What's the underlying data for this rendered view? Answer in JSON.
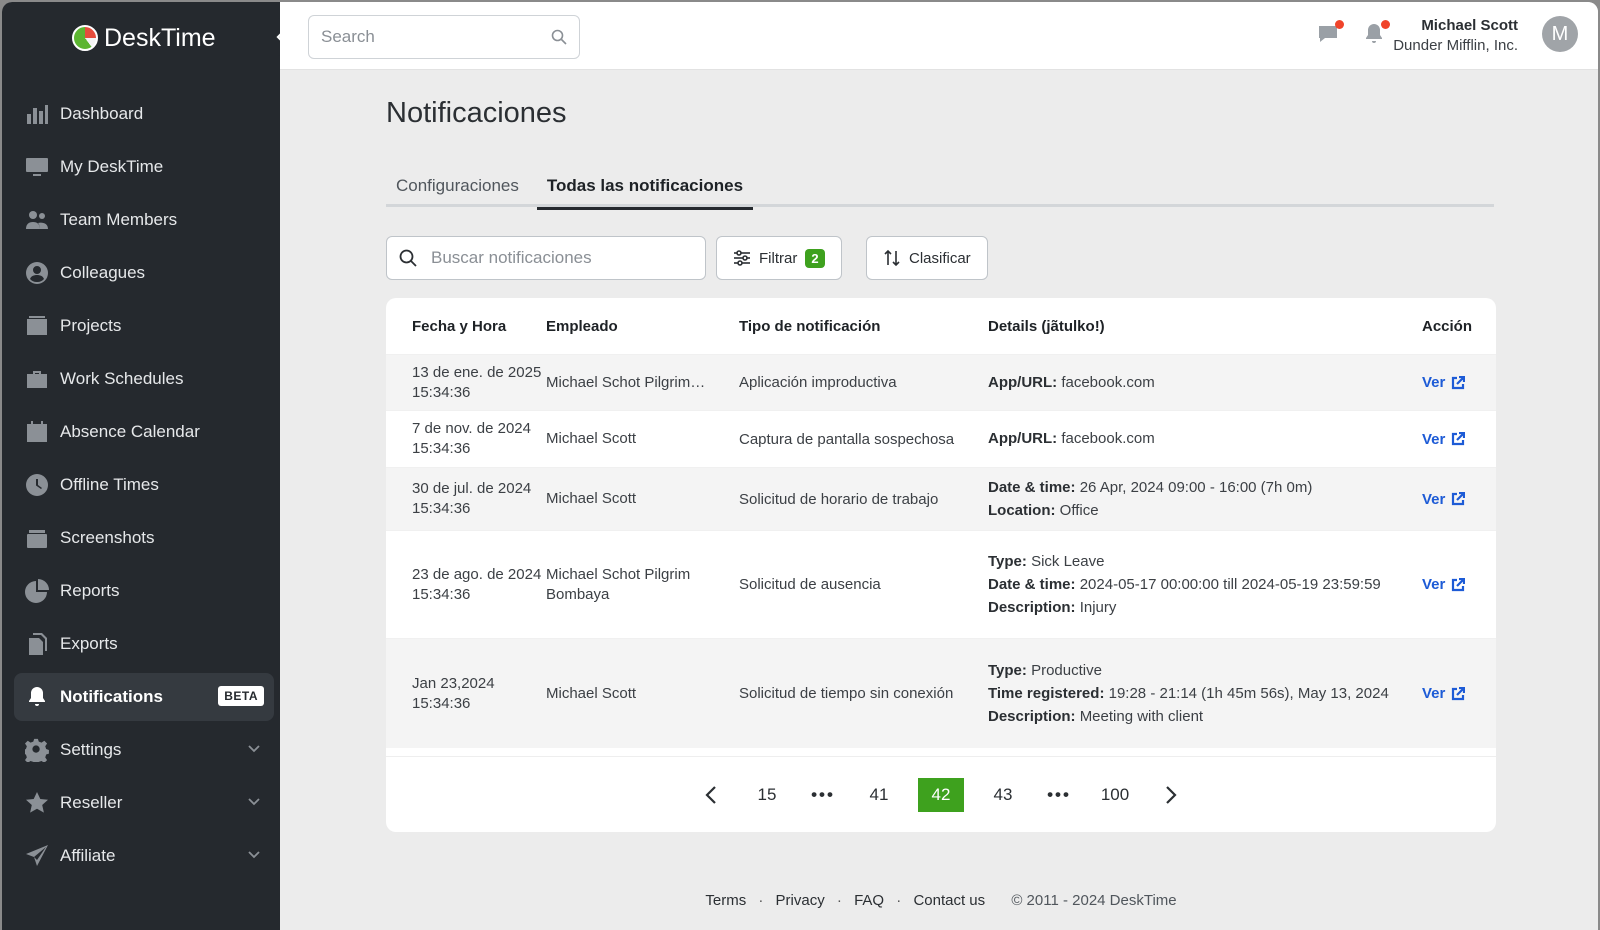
{
  "app": {
    "name": "DeskTime"
  },
  "sidebar": {
    "items": [
      {
        "label": "Dashboard",
        "icon": "bar-chart-icon"
      },
      {
        "label": "My DeskTime",
        "icon": "monitor-icon"
      },
      {
        "label": "Team Members",
        "icon": "team-icon"
      },
      {
        "label": "Colleagues",
        "icon": "person-circle-icon"
      },
      {
        "label": "Projects",
        "icon": "folder-icon"
      },
      {
        "label": "Work Schedules",
        "icon": "briefcase-icon"
      },
      {
        "label": "Absence Calendar",
        "icon": "calendar-icon"
      },
      {
        "label": "Offline Times",
        "icon": "clock-icon"
      },
      {
        "label": "Screenshots",
        "icon": "screenshots-icon"
      },
      {
        "label": "Reports",
        "icon": "pie-chart-icon"
      },
      {
        "label": "Exports",
        "icon": "documents-icon"
      },
      {
        "label": "Notifications",
        "icon": "bell-icon",
        "badge": "BETA",
        "active": true
      },
      {
        "label": "Settings",
        "icon": "gear-icon"
      },
      {
        "label": "Reseller",
        "icon": "star-icon"
      },
      {
        "label": "Affiliate",
        "icon": "paper-plane-icon"
      }
    ]
  },
  "topbar": {
    "search_placeholder": "Search",
    "user_name": "Michael Scott",
    "company": "Dunder Mifflin, Inc.",
    "avatar_letter": "M"
  },
  "page": {
    "title": "Notificaciones",
    "tabs": [
      "Configuraciones",
      "Todas las notificaciones"
    ],
    "active_tab": 1,
    "search_placeholder": "Buscar notificaciones",
    "filter_label": "Filtrar",
    "filter_count": "2",
    "sort_label": "Clasificar"
  },
  "table": {
    "headers": [
      "Fecha y Hora",
      "Empleado",
      "Tipo de notificación",
      "Details (jãtulko!)",
      "Acción"
    ],
    "rows": [
      {
        "date": "13 de ene. de 2025",
        "time": "15:34:36",
        "employee": "Michael  Schot Pilgrim…",
        "type": "Aplicación improductiva",
        "details": [
          {
            "k": "App/URL:",
            "v": "facebook.com"
          }
        ],
        "action": "Ver"
      },
      {
        "date": "7 de nov. de 2024",
        "time": "15:34:36",
        "employee": "Michael Scott",
        "type": "Captura de pantalla sospechosa",
        "details": [
          {
            "k": "App/URL:",
            "v": "facebook.com"
          }
        ],
        "action": "Ver"
      },
      {
        "date": "30 de jul. de 2024",
        "time": "15:34:36",
        "employee": "Michael Scott",
        "type": "Solicitud de horario de trabajo",
        "details": [
          {
            "k": "Date & time:",
            "v": "26 Apr, 2024 09:00 - 16:00 (7h 0m)"
          },
          {
            "k": "Location:",
            "v": "Office"
          }
        ],
        "action": "Ver"
      },
      {
        "date": "23 de ago. de 2024",
        "time": "15:34:36",
        "employee": "Michael  Schot Pilgrim Bombaya",
        "type": "Solicitud de ausencia",
        "details": [
          {
            "k": "Type:",
            "v": "Sick Leave"
          },
          {
            "k": "Date & time:",
            "v": "2024-05-17 00:00:00 till 2024-05-19 23:59:59"
          },
          {
            "k": "Description:",
            "v": "Injury"
          }
        ],
        "action": "Ver"
      },
      {
        "date": "Jan 23,2024",
        "time": "15:34:36",
        "employee": "Michael Scott",
        "type": "Solicitud de tiempo sin conexión",
        "details": [
          {
            "k": "Type:",
            "v": "Productive"
          },
          {
            "k": "Time registered:",
            "v": "19:28 - 21:14 (1h 45m 56s), May 13, 2024"
          },
          {
            "k": "Description:",
            "v": "Meeting with client"
          }
        ],
        "action": "Ver"
      }
    ]
  },
  "pagination": {
    "pages": [
      "15",
      "•••",
      "41",
      "42",
      "43",
      "•••",
      "100"
    ],
    "current": "42"
  },
  "footer": {
    "links": [
      "Terms",
      "Privacy",
      "FAQ",
      "Contact us"
    ],
    "copyright": "© 2011 - 2024 DeskTime"
  },
  "colors": {
    "sidebar_bg": "#25292e",
    "accent_green": "#3ea11e",
    "link_blue": "#1d5bd6",
    "notification_dot": "#f0442a"
  }
}
